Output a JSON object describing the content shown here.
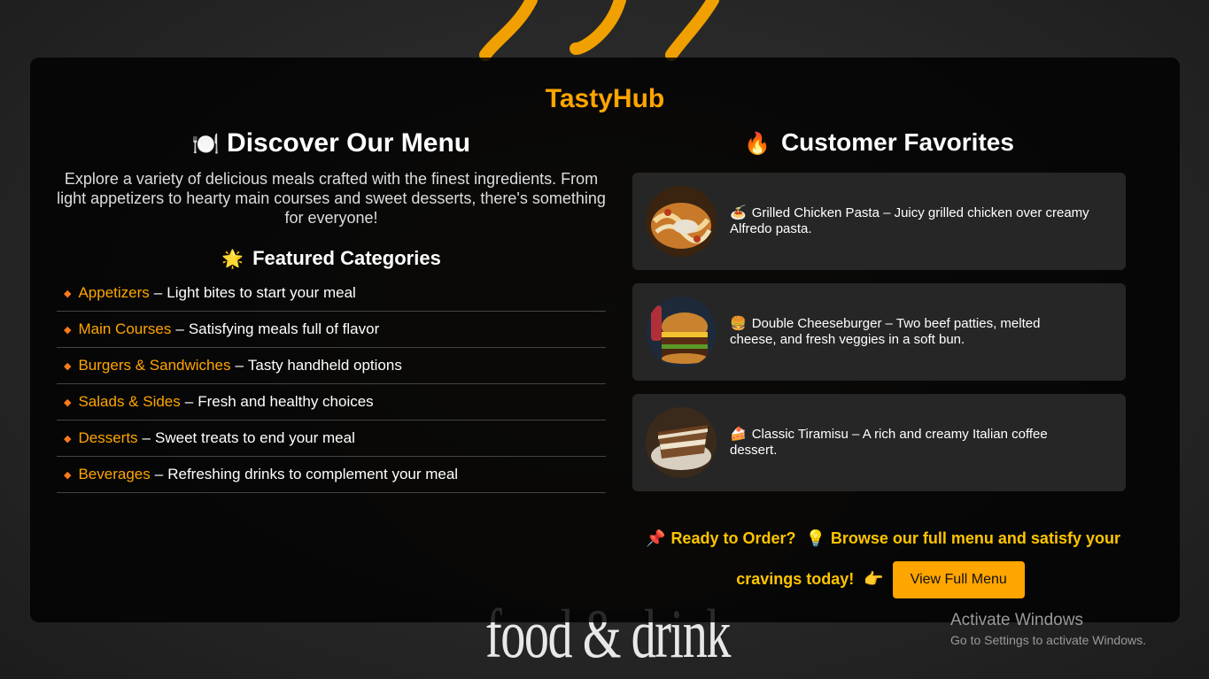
{
  "background": {
    "caption": "food & drink"
  },
  "brand": "TastyHub",
  "menu": {
    "heading_emoji": "🍽️",
    "heading": "Discover Our Menu",
    "intro": "Explore a variety of delicious meals crafted with the finest ingredients. From light appetizers to hearty main courses and sweet desserts, there's something for everyone!",
    "categories_emoji": "🌟",
    "categories_heading": "Featured Categories",
    "categories": [
      {
        "name": "Appetizers",
        "desc": "Light bites to start your meal"
      },
      {
        "name": "Main Courses",
        "desc": "Satisfying meals full of flavor"
      },
      {
        "name": "Burgers & Sandwiches",
        "desc": "Tasty handheld options"
      },
      {
        "name": "Salads & Sides",
        "desc": "Fresh and healthy choices"
      },
      {
        "name": "Desserts",
        "desc": "Sweet treats to end your meal"
      },
      {
        "name": "Beverages",
        "desc": "Refreshing drinks to complement your meal"
      }
    ],
    "bullet": "◆",
    "separator": "–"
  },
  "favorites": {
    "heading_emoji": "🔥",
    "heading": "Customer Favorites",
    "items": [
      {
        "emoji": "🍝",
        "text": "Grilled Chicken Pasta – Juicy grilled chicken over creamy Alfredo pasta."
      },
      {
        "emoji": "🍔",
        "text": "Double Cheeseburger – Two beef patties, melted cheese, and fresh veggies in a soft bun."
      },
      {
        "emoji": "🍰",
        "text": "Classic Tiramisu – A rich and creamy Italian coffee dessert."
      }
    ]
  },
  "cta": {
    "pin_emoji": "📌",
    "lead": "Ready to Order?",
    "bulb_emoji": "💡",
    "text": "Browse our full menu and satisfy your cravings today!",
    "point_emoji": "👉",
    "button_label": "View Full Menu"
  },
  "os_watermark": {
    "title": "Activate Windows",
    "subtitle": "Go to Settings to activate Windows."
  },
  "colors": {
    "accent": "#ffa500",
    "cta_text": "#ffc400",
    "bullet": "#ff7a1a"
  }
}
